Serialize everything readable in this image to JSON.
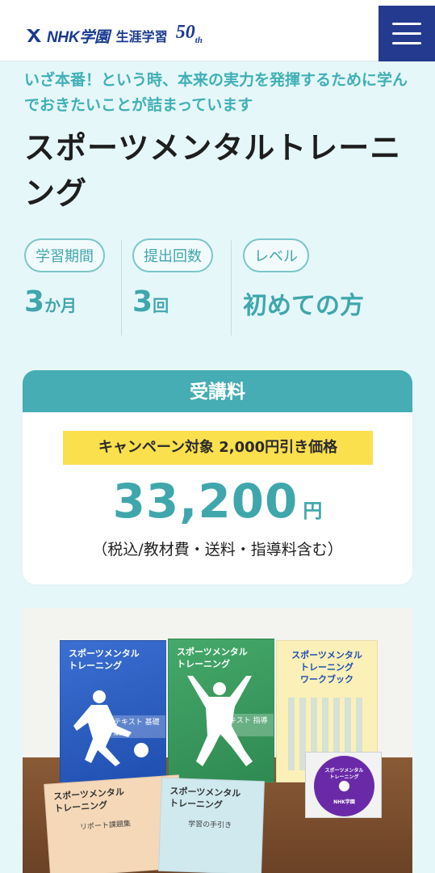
{
  "header": {
    "logo_main": "NHK学園",
    "logo_sub": "生涯学習",
    "logo_anniv": "50",
    "logo_anniv_suffix": "th",
    "menu_icon": "hamburger-menu-icon"
  },
  "course": {
    "catch": "いざ本番！という時、本来の実力を発揮するために学んでおきたいことが詰まっています",
    "title": "スポーツメンタルトレーニング"
  },
  "stats": [
    {
      "label": "学習期間",
      "value": "3",
      "unit": "か月"
    },
    {
      "label": "提出回数",
      "value": "3",
      "unit": "回"
    },
    {
      "label": "レベル",
      "value": "初めての方",
      "unit": ""
    }
  ],
  "price": {
    "heading": "受講料",
    "campaign": "キャンペーン対象 2,000円引き価格",
    "amount": "33,200",
    "currency": "円",
    "note": "（税込/教材費・送料・指導料含む）"
  },
  "product_photo": {
    "book1_title": "スポーツメンタル\nトレーニング",
    "book1_sub": "テキスト 基礎編",
    "book2_title": "スポーツメンタル\nトレーニング",
    "book2_sub": "テキスト 指導編",
    "book3_title": "スポーツメンタル\nトレーニング\nワークブック",
    "book4_title": "スポーツメンタル\nトレーニング",
    "book4_sub": "リポート課題集",
    "book5_title": "スポーツメンタル\nトレーニング",
    "book5_sub": "学習の手引き",
    "cd_title": "スポーツメンタル\nトレーニング",
    "cd_brand": "NHK学園"
  },
  "colors": {
    "accent": "#3fa7ac",
    "header_blue": "#233a8f",
    "campaign_yellow": "#fbe04d",
    "background": "#e6f7fa"
  }
}
